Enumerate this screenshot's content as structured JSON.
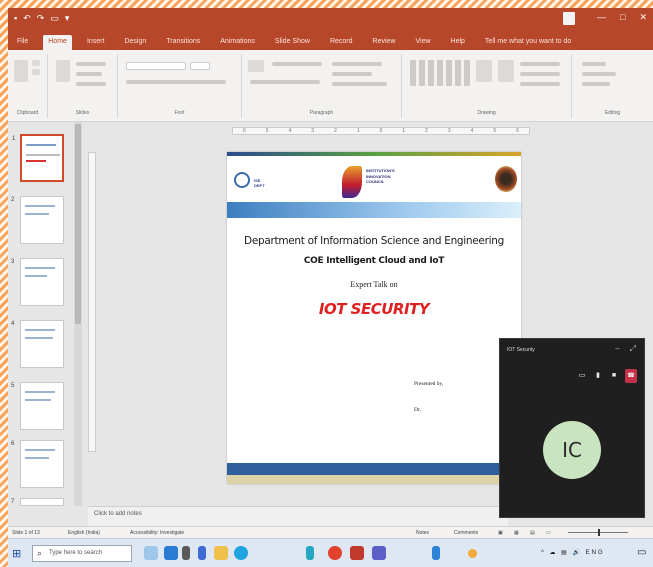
{
  "window": {
    "title": "",
    "user": "",
    "controls": [
      "—",
      "□",
      "✕"
    ]
  },
  "ribbon": {
    "tabs": [
      "File",
      "Home",
      "Insert",
      "Design",
      "Transitions",
      "Animations",
      "Slide Show",
      "Record",
      "Review",
      "View",
      "Help",
      "Tell me what you want to do"
    ],
    "active_tab_index": 1,
    "groups": [
      "Clipboard",
      "Slides",
      "Font",
      "Paragraph",
      "Drawing",
      "Editing"
    ]
  },
  "thumbnails": {
    "numbers": [
      "1",
      "2",
      "3",
      "4",
      "5",
      "6",
      "7"
    ],
    "selected_index": 0
  },
  "slide": {
    "heading": "Department of Information Science and Engineering",
    "subheading": "COE Intelligent Cloud and IoT",
    "talk_label": "Expert Talk on",
    "topic": "IOT SECURITY",
    "presented_by": "Presented by,",
    "presenter_prefix": "Dr.",
    "presenter_name": "",
    "presenter_role": ""
  },
  "notes": {
    "placeholder": "Click to add notes"
  },
  "meeting": {
    "title": "IOT Security",
    "time": "",
    "avatar_initials": "IC",
    "hangup_color": "#c4314b",
    "avatar_color": "#c9e4c1"
  },
  "statusbar": {
    "slide_info": "Slide 1 of 13",
    "language": "English (India)",
    "accessibility": "Accessibility: Investigate",
    "notes": "Notes",
    "comments": "Comments",
    "zoom": ""
  },
  "taskbar": {
    "search_placeholder": "Type here to search",
    "weather": "",
    "time": "",
    "date": ""
  },
  "colors": {
    "accent": "#b7472a",
    "topic_red": "#e02020"
  }
}
